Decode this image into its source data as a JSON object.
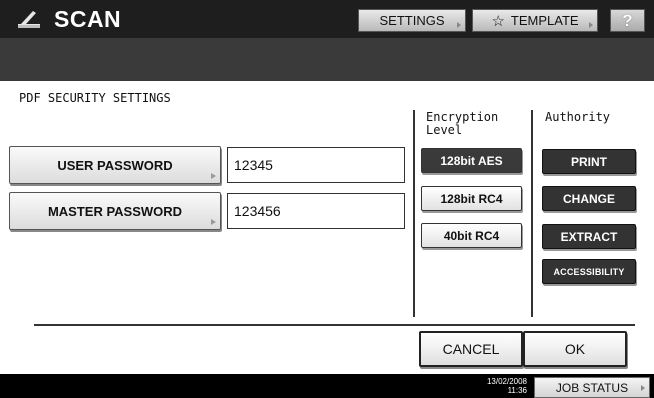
{
  "header": {
    "title": "SCAN",
    "logo_icon": "scanner-icon",
    "settings_label": "SETTINGS",
    "template_label": "TEMPLATE",
    "template_icon": "star-icon",
    "help_label": "?"
  },
  "main": {
    "section_title": "PDF SECURITY SETTINGS",
    "user_password": {
      "label": "USER PASSWORD",
      "value": "12345"
    },
    "master_password": {
      "label": "MASTER PASSWORD",
      "value": "123456"
    }
  },
  "encryption": {
    "heading_line1": "Encryption",
    "heading_line2": "Level",
    "options": [
      "128bit AES",
      "128bit RC4",
      "40bit RC4"
    ],
    "selected": "128bit AES"
  },
  "authority": {
    "heading": "Authority",
    "options": [
      "PRINT",
      "CHANGE",
      "EXTRACT",
      "ACCESSIBILITY"
    ]
  },
  "actions": {
    "cancel_label": "CANCEL",
    "ok_label": "OK"
  },
  "footer": {
    "date": "13/02/2008",
    "time": "11:36",
    "job_status_label": "JOB STATUS"
  },
  "colors": {
    "header_bg": "#1e1e1e",
    "subbar_bg": "#3a3a3a",
    "selected_button_bg": "#3a3a3a",
    "authority_button_bg": "#333333"
  }
}
